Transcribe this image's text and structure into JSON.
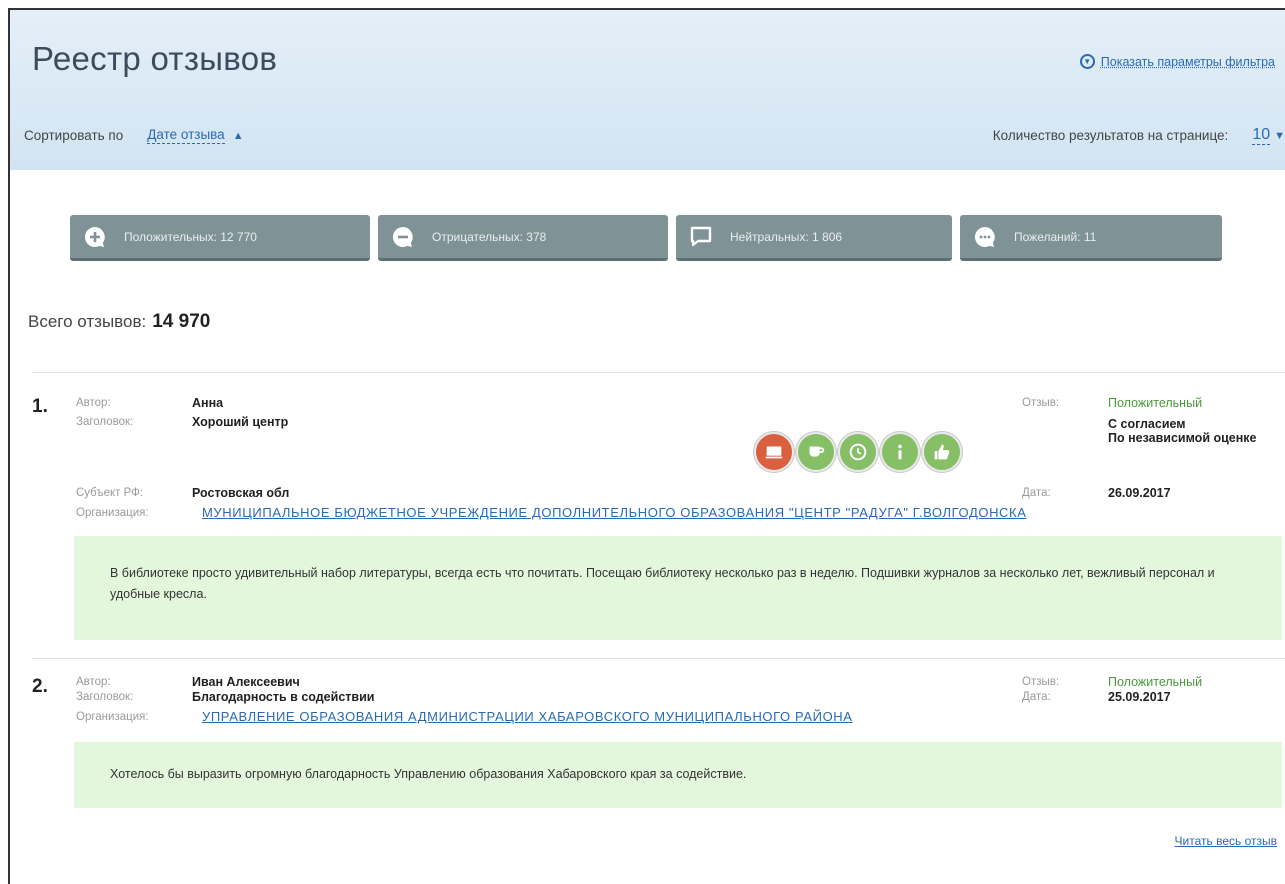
{
  "header": {
    "title": "Реестр отзывов",
    "filter_link": "Показать параметры фильтра",
    "sort_label": "Сортировать по",
    "sort_value": "Дате отзыва",
    "per_page_label": "Количество результатов на странице:",
    "per_page_value": "10"
  },
  "stats": [
    {
      "label": "Положительных: 12 770",
      "icon": "plus-bubble-icon"
    },
    {
      "label": "Отрицательных: 378",
      "icon": "minus-bubble-icon"
    },
    {
      "label": "Нейтральных: 1 806",
      "icon": "empty-bubble-icon"
    },
    {
      "label": "Пожеланий: 11",
      "icon": "dots-bubble-icon"
    }
  ],
  "total": {
    "label": "Всего отзывов:",
    "value": "14 970"
  },
  "labels": {
    "author": "Автор:",
    "title": "Заголовок:",
    "region": "Субъект РФ:",
    "organization": "Организация:",
    "review": "Отзыв:",
    "date": "Дата:"
  },
  "reviews": [
    {
      "number": "1.",
      "author": "Анна",
      "title": "Хороший центр",
      "region": "Ростовская обл",
      "organization": "МУНИЦИПАЛЬНОЕ БЮДЖЕТНОЕ УЧРЕЖДЕНИЕ ДОПОЛНИТЕЛЬНОГО ОБРАЗОВАНИЯ \"ЦЕНТР \"РАДУГА\" Г.ВОЛГОДОНСКА",
      "sentiment": "Положительный",
      "consent_1": "С согласием",
      "consent_2": "По независимой оценке",
      "date": "26.09.2017",
      "text": "В библиотеке просто удивительный набор литературы, всегда есть что почитать. Посещаю библиотеку несколько раз в неделю. Подшивки журналов за несколько лет, вежливый персонал и удобные кресла.",
      "badge_icons": [
        "tray-icon",
        "cup-icon",
        "clock-icon",
        "info-icon",
        "thumbs-up-icon"
      ]
    },
    {
      "number": "2.",
      "author": "Иван Алексеевич",
      "title": "Благодарность в содействии",
      "organization": "УПРАВЛЕНИЕ ОБРАЗОВАНИЯ АДМИНИСТРАЦИИ ХАБАРОВСКОГО МУНИЦИПАЛЬНОГО РАЙОНА",
      "sentiment": "Положительный",
      "date": "25.09.2017",
      "text": "Хотелось бы выразить огромную благодарность Управлению образования Хабаровского края за содействие."
    }
  ],
  "read_all": "Читать весь отзыв",
  "colors": {
    "accent": "#2a6ab4",
    "positive": "#4a9a3a",
    "text_bg": "#e3f7dd",
    "stat_btn": "#7f9396"
  }
}
